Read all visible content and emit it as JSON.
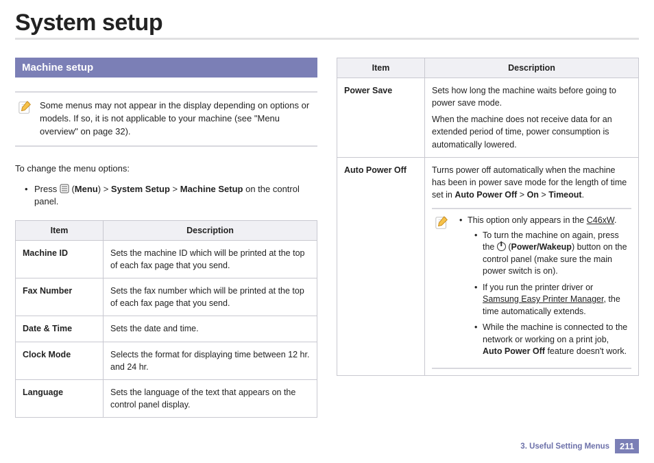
{
  "page": {
    "title": "System setup",
    "chapter": "3.  Useful Setting Menus",
    "page_number": "211"
  },
  "left": {
    "section_title": "Machine setup",
    "note": "Some menus may not appear in the display depending on options or models. If so, it is not applicable to your machine (see \"Menu overview\" on page 32).",
    "intro": "To change the menu options:",
    "step_prefix": "Press ",
    "step_menu": "Menu",
    "step_sep": " > ",
    "step_lvl1": "System Setup",
    "step_lvl2": "Machine Setup",
    "step_suffix": " on the control panel.",
    "headers": {
      "item": "Item",
      "desc": "Description"
    },
    "rows": [
      {
        "item": "Machine ID",
        "desc": "Sets the machine ID which will be printed at the top of each fax page that you send."
      },
      {
        "item": "Fax Number",
        "desc": "Sets the fax number which will be printed at the top of each fax page that you send."
      },
      {
        "item": "Date & Time",
        "desc": "Sets the date and time."
      },
      {
        "item": "Clock Mode",
        "desc": "Selects the format for displaying time between 12 hr. and 24 hr."
      },
      {
        "item": "Language",
        "desc": "Sets the language of the text that appears on the control panel display."
      }
    ]
  },
  "right": {
    "headers": {
      "item": "Item",
      "desc": "Description"
    },
    "rows": [
      {
        "item": "Power Save",
        "desc_a": "Sets how long the machine waits before going to power save mode.",
        "desc_b": "When the machine does not receive data for an extended period of time, power consumption is automatically lowered."
      },
      {
        "item": "Auto Power Off",
        "desc_pre": "Turns power off automatically when the machine has been in power save mode for the length of time set in ",
        "path1": "Auto Power Off",
        "path2": "On",
        "path3": "Timeout",
        "note_line1_pre": "This option only appears in the ",
        "note_line1_link": "C46xW",
        "note_line1_post": ".",
        "sub1_pre": "To turn the machine on again, press the ",
        "sub1_mid": " (",
        "sub1_bold": "Power/Wakeup",
        "sub1_post": ") button on the control panel (make sure the main power switch is on).",
        "sub2_pre": "If you run the printer driver or ",
        "sub2_link": "Samsung Easy Printer Manager",
        "sub2_post": ", the time automatically extends.",
        "sub3_pre": "While the machine is connected to the network or working on a print job, ",
        "sub3_bold": "Auto Power Off",
        "sub3_post": " feature doesn't work."
      }
    ]
  }
}
